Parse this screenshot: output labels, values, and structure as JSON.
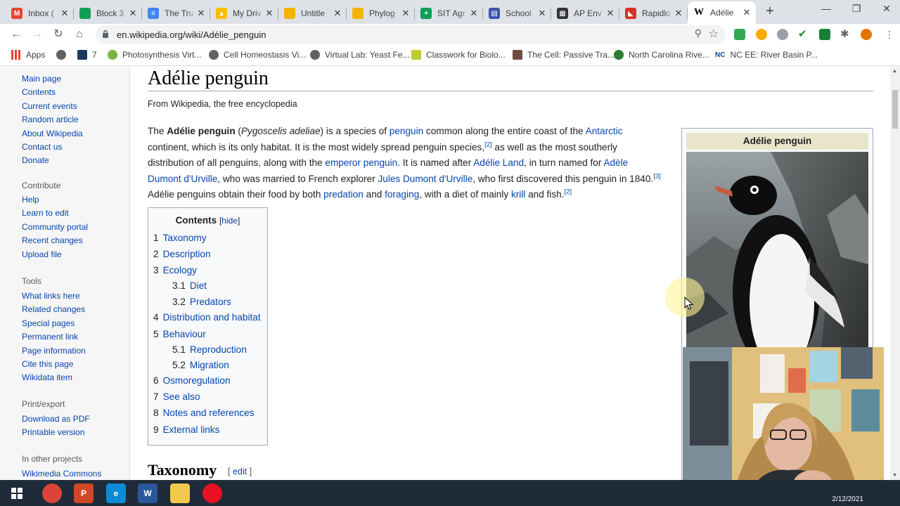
{
  "browser": {
    "tabs": [
      {
        "title": "Inbox (",
        "icon": "gmail-icon",
        "color": "#ea4335",
        "glyph": "M"
      },
      {
        "title": "Block 3",
        "icon": "classroom-icon",
        "color": "#0f9d58",
        "glyph": ""
      },
      {
        "title": "The Tru",
        "icon": "docs-icon",
        "color": "#4285f4",
        "glyph": "≡"
      },
      {
        "title": "My Driv",
        "icon": "drive-icon",
        "color": "#fbbc05",
        "glyph": "▲"
      },
      {
        "title": "Untitle",
        "icon": "slides-icon",
        "color": "#f4b400",
        "glyph": ""
      },
      {
        "title": "Phylog",
        "icon": "slides-icon",
        "color": "#f4b400",
        "glyph": ""
      },
      {
        "title": "SIT Agr",
        "icon": "sheets-icon",
        "color": "#0f9d58",
        "glyph": "+"
      },
      {
        "title": "School",
        "icon": "forms-icon",
        "color": "#3f51b5",
        "glyph": "▤"
      },
      {
        "title": "AP Env",
        "icon": "document-icon",
        "color": "#333333",
        "glyph": "▦"
      },
      {
        "title": "Rapidlo",
        "icon": "rapidlo-icon",
        "color": "#d93025",
        "glyph": "◣"
      },
      {
        "title": "Adélie",
        "icon": "wikipedia-icon",
        "color": "#ffffff",
        "glyph": "W",
        "active": true
      }
    ],
    "url": "en.wikipedia.org/wiki/Adélie_penguin",
    "bookmarks": [
      {
        "label": "Apps",
        "color": "#5f6368"
      },
      {
        "label": "",
        "color": "#5f6368"
      },
      {
        "label": "7",
        "color": "#1a3b5d"
      },
      {
        "label": "Photosynthesis Virt...",
        "color": "#7cb342"
      },
      {
        "label": "Cell Homeostasis Vi...",
        "color": "#5f6368"
      },
      {
        "label": "Virtual Lab: Yeast Fe...",
        "color": "#5f6368"
      },
      {
        "label": "Classwork for Biolo...",
        "color": "#c0ca33"
      },
      {
        "label": "The Cell: Passive Tra...",
        "color": "#6d4c41"
      },
      {
        "label": "North Carolina Rive...",
        "color": "#2e7d32"
      },
      {
        "label": "NC EE: River Basin P...",
        "color": "#0d47a1"
      }
    ]
  },
  "sidebar": {
    "nav": [
      "Main page",
      "Contents",
      "Current events",
      "Random article",
      "About Wikipedia",
      "Contact us",
      "Donate"
    ],
    "contribute_heading": "Contribute",
    "contribute": [
      "Help",
      "Learn to edit",
      "Community portal",
      "Recent changes",
      "Upload file"
    ],
    "tools_heading": "Tools",
    "tools": [
      "What links here",
      "Related changes",
      "Special pages",
      "Permanent link",
      "Page information",
      "Cite this page",
      "Wikidata item"
    ],
    "print_heading": "Print/export",
    "print": [
      "Download as PDF",
      "Printable version"
    ],
    "projects_heading": "In other projects",
    "projects": [
      "Wikimedia Commons"
    ]
  },
  "article": {
    "title": "Adélie penguin",
    "tagline": "From Wikipedia, the free encyclopedia",
    "intro": {
      "t1": "The ",
      "bold": "Adélie penguin",
      "t2": " (",
      "italic": "Pygoscelis adeliae",
      "t3": ") is a species of ",
      "l_penguin": "penguin",
      "t4": " common along the entire coast of the ",
      "l_antarctic": "Antarctic",
      "t5": " continent, which is its only habitat. It is the most widely spread penguin species,",
      "ref2a": "[2]",
      "t6": " as well as the most southerly distribution of all penguins, along with the ",
      "l_emperor": "emperor penguin",
      "t7": ". It is named after ",
      "l_adelie_land": "Adélie Land",
      "t8": ", in turn named for ",
      "l_adele": "Adèle Dumont d'Urville",
      "t9": ", who was married to French explorer ",
      "l_jules": "Jules Dumont d'Urville",
      "t10": ", who first discovered this penguin in 1840.",
      "ref3": "[3]",
      "t11": " Adélie penguins obtain their food by both ",
      "l_predation": "predation",
      "t12": " and ",
      "l_foraging": "foraging",
      "t13": ", with a diet of mainly ",
      "l_krill": "krill",
      "t14": " and fish.",
      "ref2b": "[2]"
    },
    "toc": {
      "title": "Contents",
      "hide_open": "[",
      "hide_label": "hide",
      "hide_close": "]",
      "items": [
        {
          "num": "1",
          "label": "Taxonomy"
        },
        {
          "num": "2",
          "label": "Description"
        },
        {
          "num": "3",
          "label": "Ecology"
        },
        {
          "num": "3.1",
          "label": "Diet"
        },
        {
          "num": "3.2",
          "label": "Predators"
        },
        {
          "num": "4",
          "label": "Distribution and habitat"
        },
        {
          "num": "5",
          "label": "Behaviour"
        },
        {
          "num": "5.1",
          "label": "Reproduction"
        },
        {
          "num": "5.2",
          "label": "Migration"
        },
        {
          "num": "6",
          "label": "Osmoregulation"
        },
        {
          "num": "7",
          "label": "See also"
        },
        {
          "num": "8",
          "label": "Notes and references"
        },
        {
          "num": "9",
          "label": "External links"
        }
      ]
    },
    "section_heading": "Taxonomy",
    "edit_open": "[ ",
    "edit_label": "edit",
    "edit_close": " ]",
    "infobox": {
      "title": "Adélie penguin"
    }
  },
  "taskbar": {
    "apps": [
      {
        "name": "chrome-icon",
        "color": "#db4437"
      },
      {
        "name": "powerpoint-icon",
        "color": "#d24726"
      },
      {
        "name": "edge-icon",
        "color": "#0c8ad6"
      },
      {
        "name": "word-icon",
        "color": "#2b579a"
      },
      {
        "name": "file-explorer-icon",
        "color": "#f2c94c"
      },
      {
        "name": "record-icon",
        "color": "#e81123"
      }
    ],
    "date": "2/12/2021"
  }
}
